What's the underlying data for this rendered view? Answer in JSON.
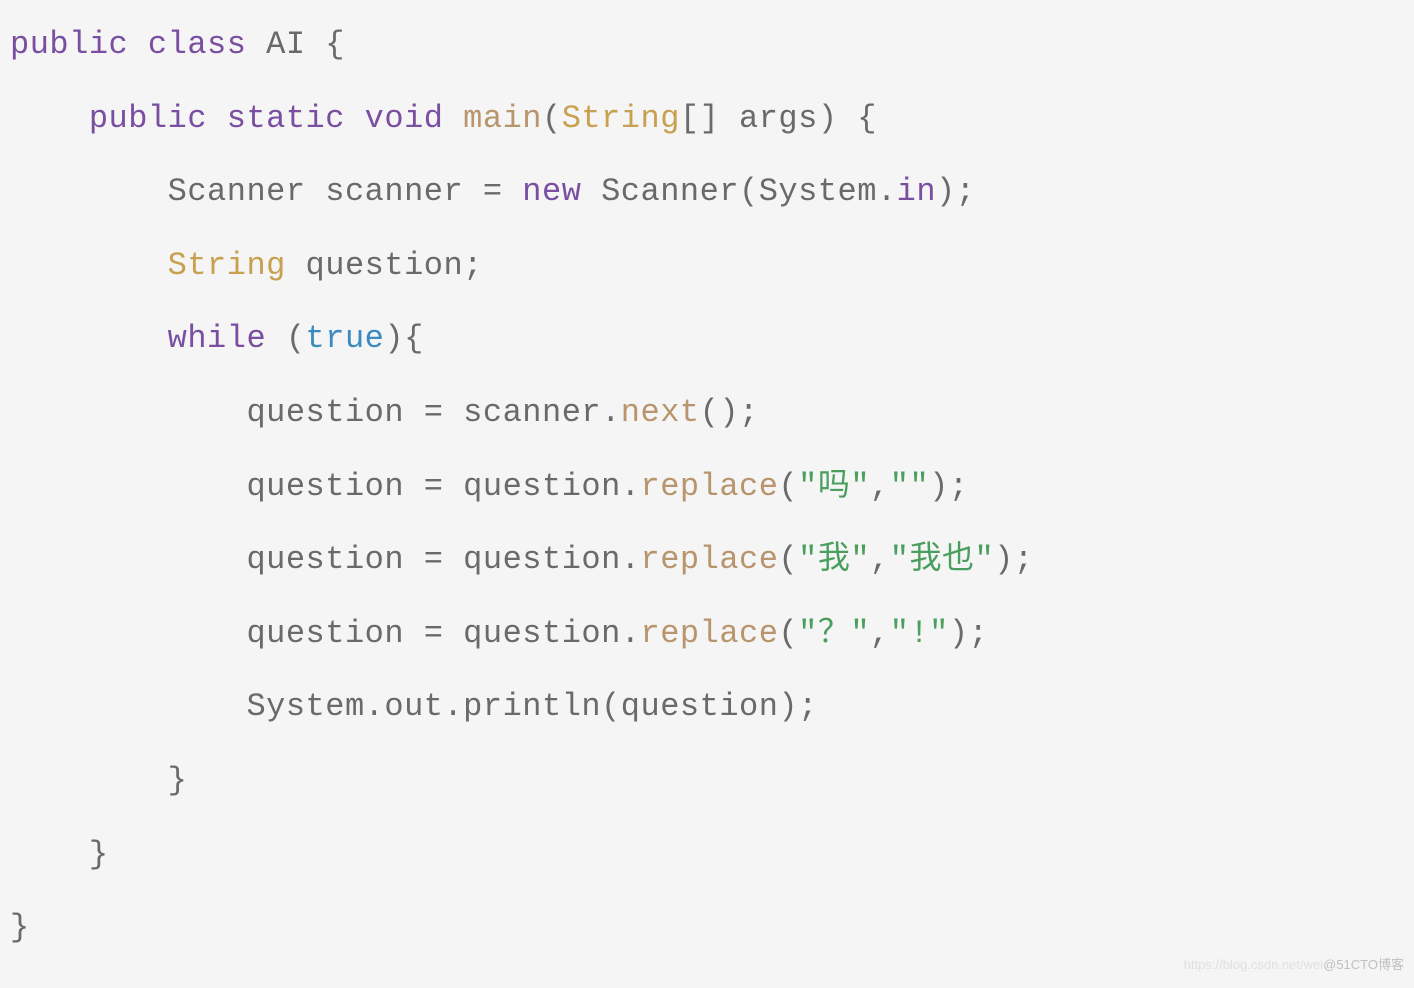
{
  "code": {
    "l1": {
      "kw_public": "public",
      "kw_class": "class",
      "classname": "AI",
      "brace": " {"
    },
    "l2": {
      "indent": "    ",
      "kw_public": "public",
      "kw_static": "static",
      "kw_void": "void",
      "method": "main",
      "paren_open": "(",
      "type_string": "String",
      "args": "[] args) {"
    },
    "l3": {
      "indent": "        ",
      "text1": "Scanner scanner = ",
      "kw_new": "new",
      "text2": " Scanner(System.",
      "field_in": "in",
      "text3": ");"
    },
    "l4": {
      "indent": "        ",
      "type_string": "String",
      "text": " question;"
    },
    "l5": {
      "indent": "        ",
      "kw_while": "while",
      "paren_open": " (",
      "literal_true": "true",
      "text": "){"
    },
    "l6": {
      "indent": "            ",
      "text1": "question = scanner.",
      "method_next": "next",
      "text2": "();"
    },
    "l7": {
      "indent": "            ",
      "text1": "question = question.",
      "method_replace": "replace",
      "paren_open": "(",
      "str1": "\"吗\"",
      "comma": ",",
      "str2": "\"\"",
      "text2": ");"
    },
    "l8": {
      "indent": "            ",
      "text1": "question = question.",
      "method_replace": "replace",
      "paren_open": "(",
      "str1": "\"我\"",
      "comma": ",",
      "str2": "\"我也\"",
      "text2": ");"
    },
    "l9": {
      "indent": "            ",
      "text1": "question = question.",
      "method_replace": "replace",
      "paren_open": "(",
      "str1": "\"？\"",
      "comma": ",",
      "str2": "\"!\"",
      "text2": ");"
    },
    "l10": {
      "indent": "            ",
      "text": "System.out.println(question);"
    },
    "l11": {
      "indent": "        ",
      "brace": "}"
    },
    "l12": {
      "indent": "    ",
      "brace": "}"
    },
    "l13": {
      "brace": "}"
    }
  },
  "watermark": {
    "light": "https://blog.csdn.net/wei",
    "dark": "@51CTO博客"
  }
}
